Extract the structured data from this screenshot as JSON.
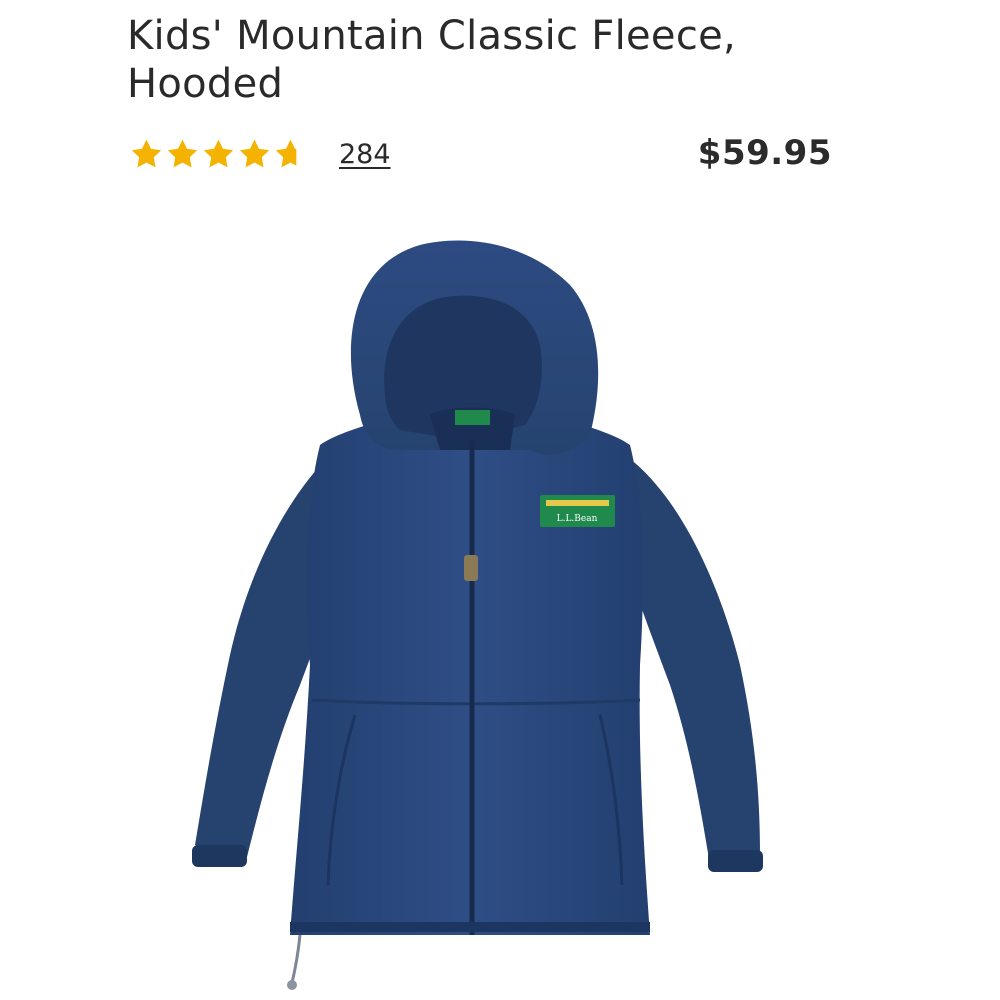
{
  "product": {
    "title": "Kids' Mountain Classic Fleece, Hooded",
    "rating": 4.7,
    "rating_max": 5,
    "review_count": "284",
    "price": "$59.95",
    "brand_label": "L.L.Bean",
    "image_subject": "navy blue hooded full-zip fleece jacket"
  },
  "colors": {
    "star": "#f5b301",
    "star_empty": "#d9d9d9",
    "fleece": "#2c4a80",
    "patch": "#1f8a4c"
  }
}
